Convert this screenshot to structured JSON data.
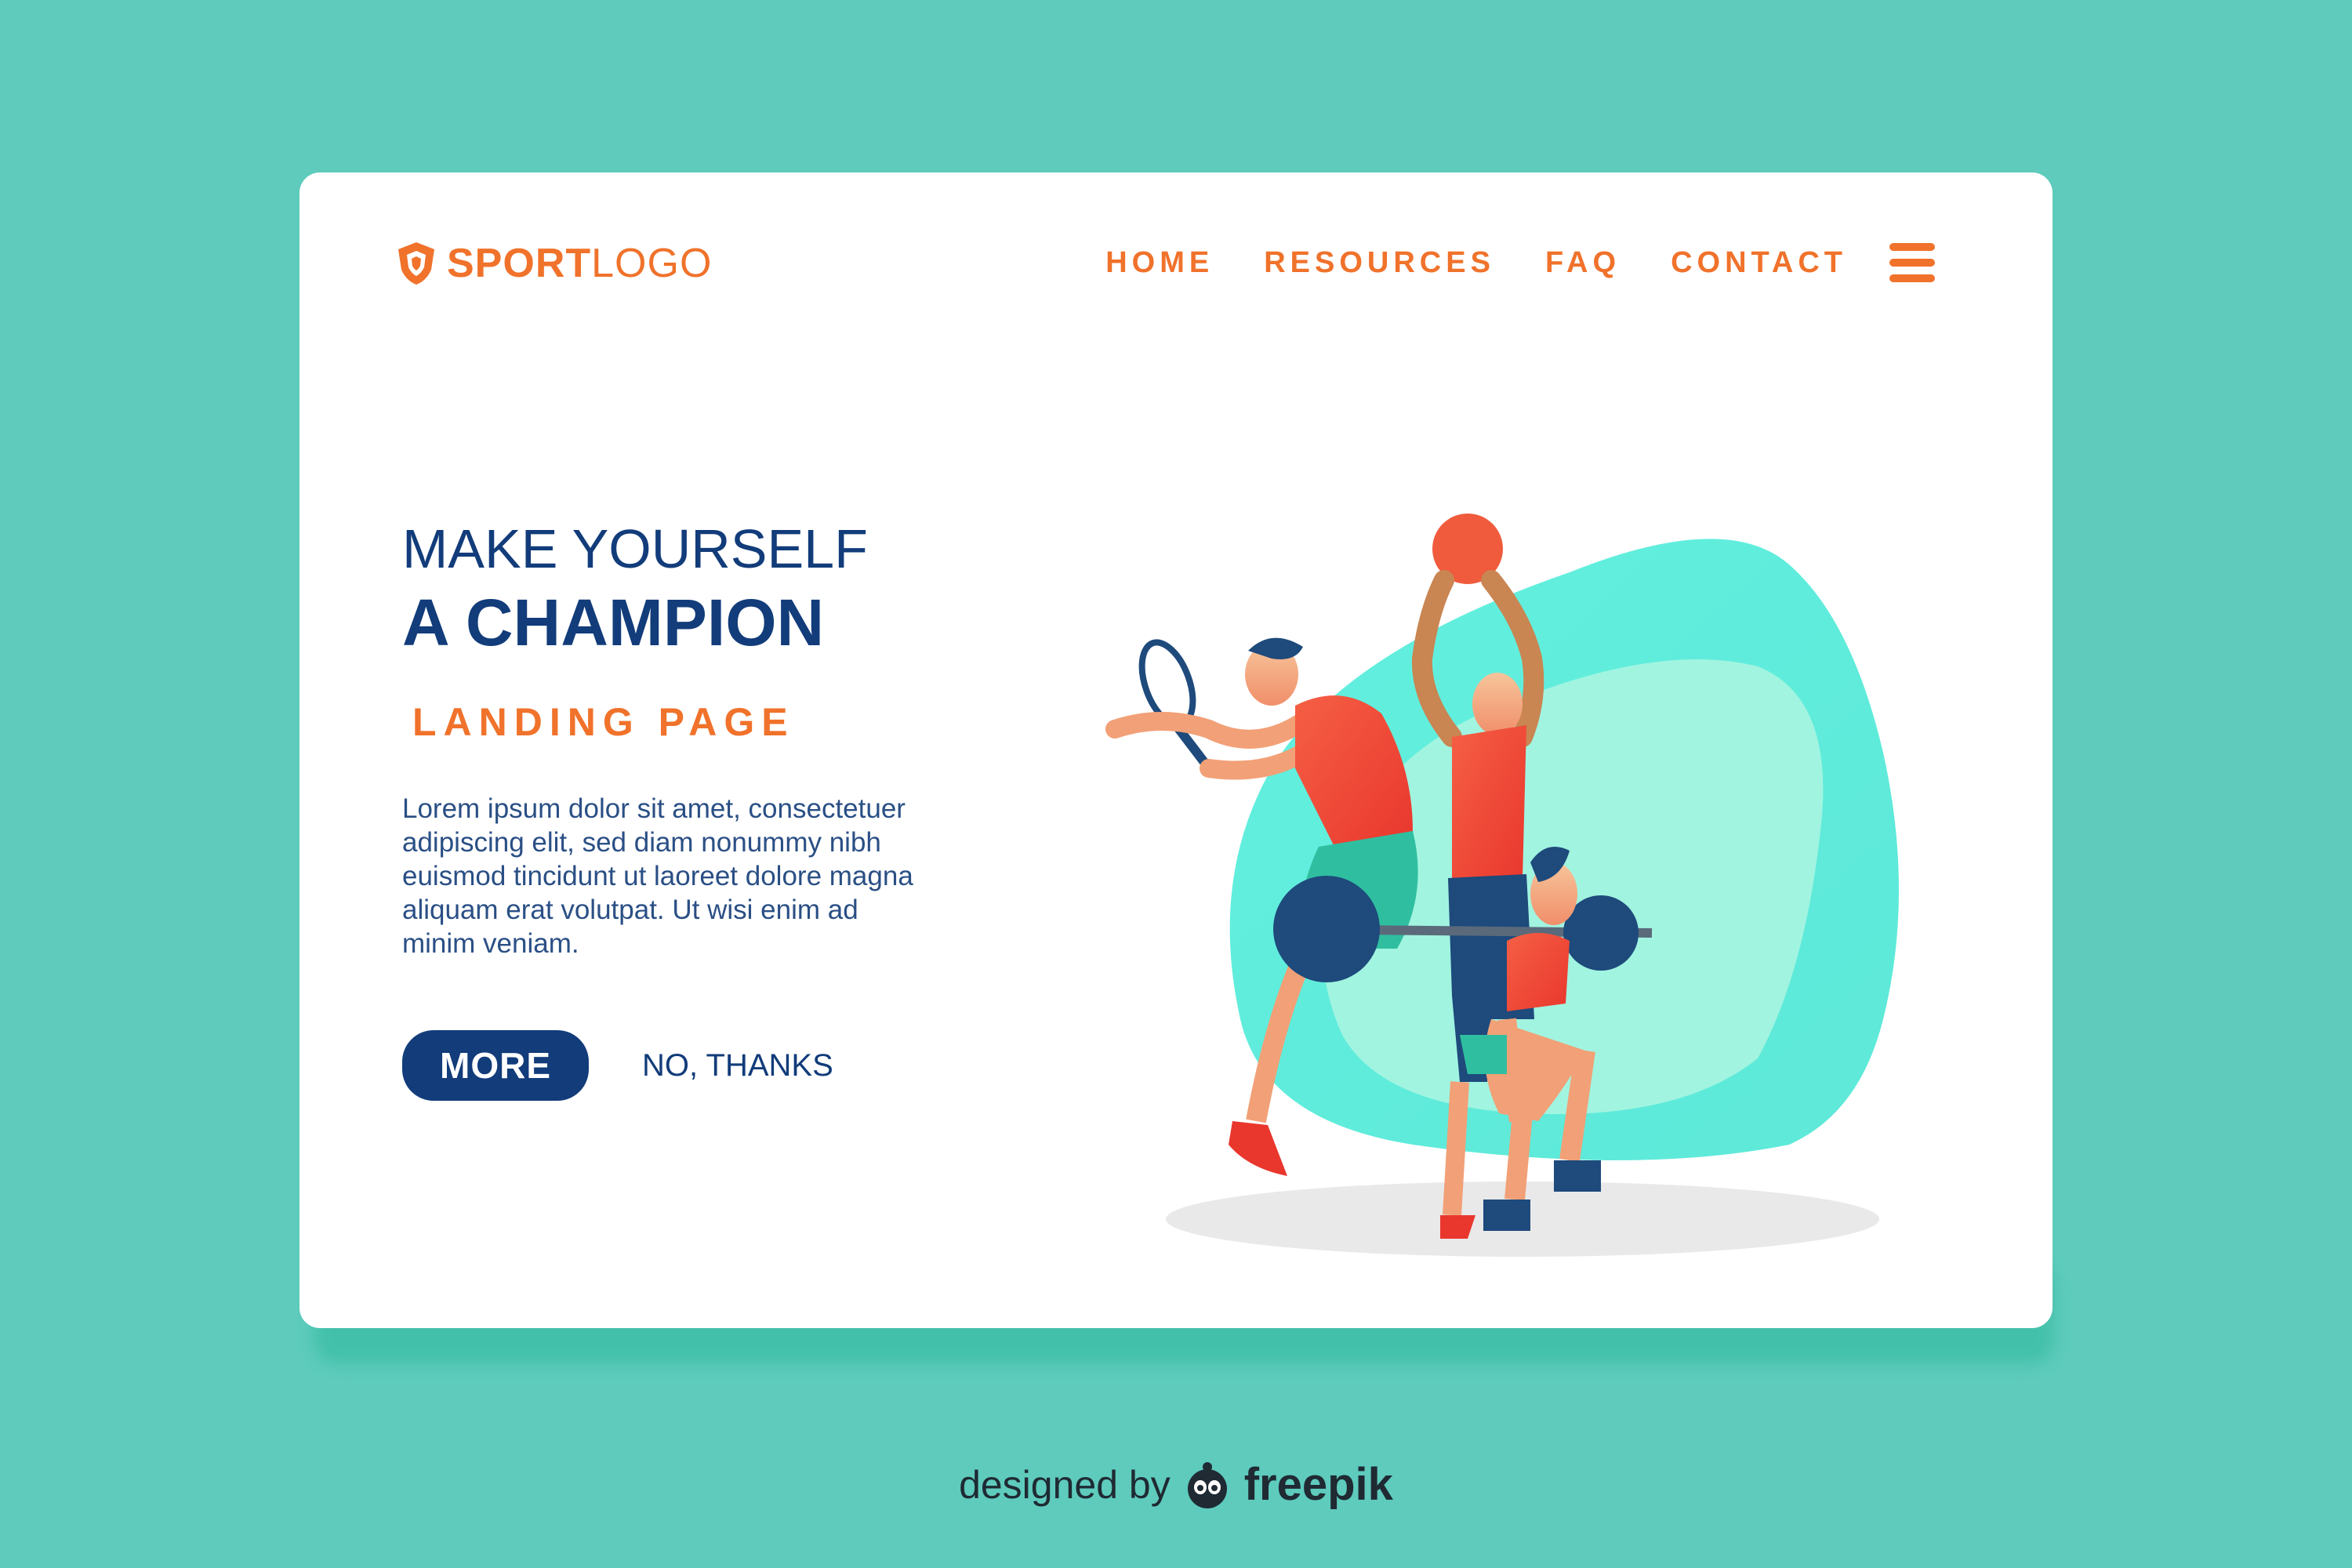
{
  "header": {
    "logo": {
      "bold": "SPORT",
      "light": "LOGO",
      "icon": "shield-icon"
    },
    "nav": [
      "HOME",
      "RESOURCES",
      "FAQ",
      "CONTACT"
    ],
    "menu_icon": "hamburger-menu-icon"
  },
  "hero": {
    "line1": "MAKE YOURSELF",
    "line2": "A CHAMPION",
    "subtitle": "LANDING PAGE",
    "body": "Lorem ipsum dolor sit amet, consectetuer adipiscing elit, sed diam nonummy nibh euismod tincidunt ut laoreet dolore magna aliquam erat volutpat. Ut wisi enim ad minim veniam.",
    "primary_button": "MORE",
    "secondary_button": "NO, THANKS"
  },
  "footer": {
    "prefix": "designed by",
    "brand": "freepik",
    "icon": "freepik-logo-icon"
  },
  "colors": {
    "background": "#5ecbbd",
    "card": "#ffffff",
    "accent_orange": "#f0722b",
    "navy": "#123c7a",
    "mint_blob": "#63f0df"
  }
}
